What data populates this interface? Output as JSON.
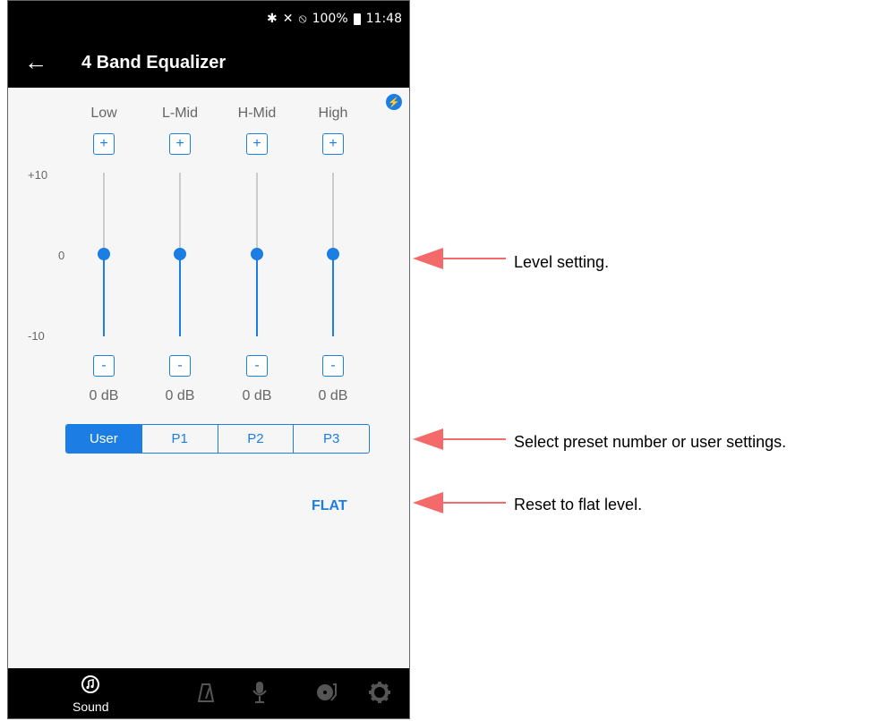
{
  "statusbar": {
    "battery": "100%",
    "time": "11:48",
    "icons": [
      "bluetooth-icon",
      "mute-icon",
      "blocked-icon"
    ]
  },
  "header": {
    "back_icon": "←",
    "title": "4 Band Equalizer"
  },
  "bands": [
    {
      "label": "Low",
      "value": "0 dB"
    },
    {
      "label": "L-Mid",
      "value": "0 dB"
    },
    {
      "label": "H-Mid",
      "value": "0 dB"
    },
    {
      "label": "High",
      "value": "0 dB"
    }
  ],
  "steppers": {
    "plus": "+",
    "minus": "-"
  },
  "axis": {
    "top": "+10",
    "mid": "0",
    "bottom": "-10"
  },
  "presets": {
    "options": [
      "User",
      "P1",
      "P2",
      "P3"
    ],
    "selected": "User"
  },
  "flat_label": "FLAT",
  "bottom_nav": {
    "sound_label": "Sound"
  },
  "callouts": {
    "level": "Level setting.",
    "preset": "Select preset number or user settings.",
    "reset": "Reset to flat level."
  },
  "colors": {
    "accent": "#1c7ee5",
    "arrow": "#f46a6a",
    "bar": "#000000"
  }
}
